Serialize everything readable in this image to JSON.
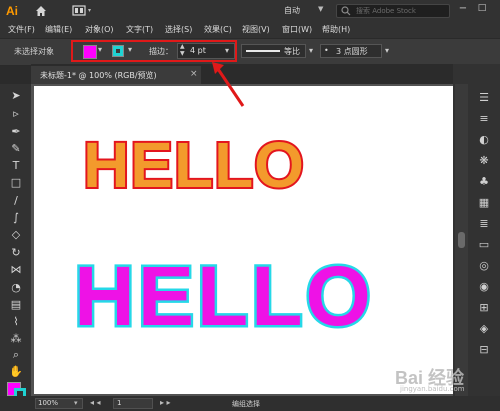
{
  "app": {
    "logo": "Ai",
    "workspace": "自动",
    "search_placeholder": "搜索 Adobe Stock"
  },
  "menu": [
    "文件(F)",
    "编辑(E)",
    "对象(O)",
    "文字(T)",
    "选择(S)",
    "效果(C)",
    "视图(V)",
    "窗口(W)",
    "帮助(H)"
  ],
  "control": {
    "selection": "未选择对象",
    "fill_color": "#ff00ff",
    "stroke_color": "#1fd3d3",
    "stroke_label": "描边：",
    "stroke_weight": "4 pt",
    "profile_label": "等比",
    "brush_label": "3 点圆形",
    "highlight_color": "#e01919"
  },
  "tab": {
    "label": "未标题-1* @ 100% (RGB/预览)",
    "close": "×"
  },
  "artwork": {
    "text1": "HELLO",
    "text1_fill": "#f39a2c",
    "text1_stroke": "#e3151e",
    "text2": "HELLO",
    "text2_fill": "#ee12e6",
    "text2_stroke": "#25d8e8"
  },
  "status": {
    "zoom": "100%",
    "page": "1",
    "text": "编组选择"
  },
  "watermark": {
    "main": "Bai 经验",
    "sub": "jingyan.baidu.com"
  }
}
